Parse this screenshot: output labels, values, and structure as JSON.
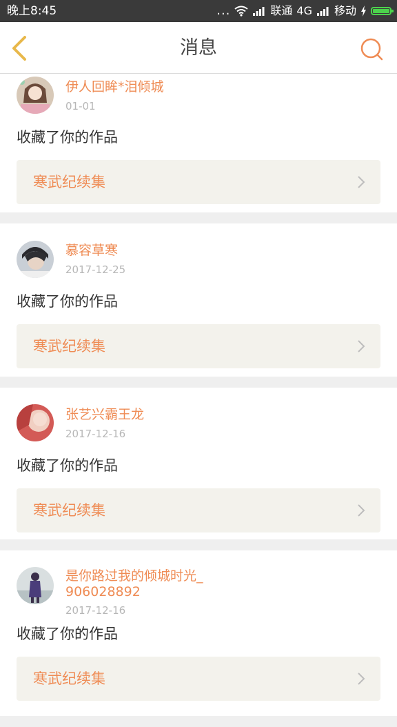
{
  "status_bar": {
    "time": "晚上8:45",
    "dots": "...",
    "carrier1": "联通",
    "network": "4G",
    "carrier2": "移动"
  },
  "header": {
    "title": "消息",
    "back_icon": "chevron-left-icon",
    "search_icon": "search-icon"
  },
  "colors": {
    "accent": "#ef8c55",
    "back_icon": "#e8b84a",
    "card_link_bg": "#f3f2ec",
    "battery": "#4cd24c"
  },
  "messages": [
    {
      "user": "伊人回眸*泪倾城",
      "date": "01-01",
      "action": "收藏了你的作品",
      "work": "寒武纪续集"
    },
    {
      "user": "慕容草寒",
      "date": "2017-12-25",
      "action": "收藏了你的作品",
      "work": "寒武纪续集"
    },
    {
      "user": "张艺兴霸王龙",
      "date": "2017-12-16",
      "action": "收藏了你的作品",
      "work": "寒武纪续集"
    },
    {
      "user": "是你路过我的倾城时光_906028892",
      "date": "2017-12-16",
      "action": "收藏了你的作品",
      "work": "寒武纪续集"
    }
  ]
}
